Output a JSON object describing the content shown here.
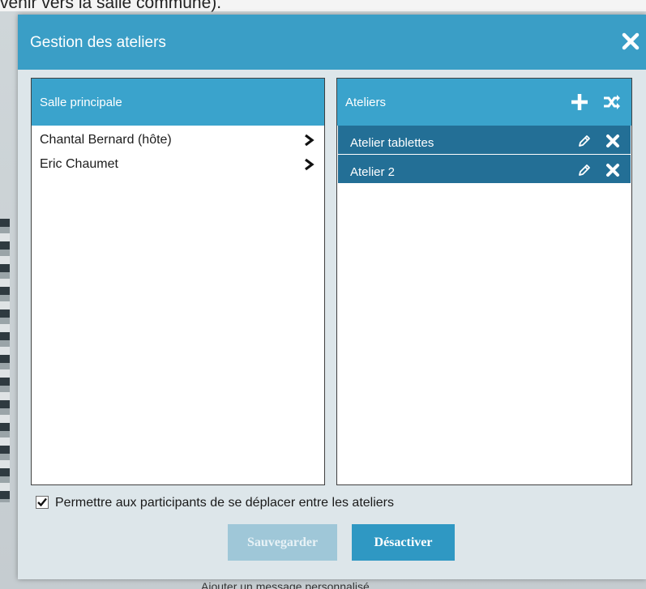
{
  "background": {
    "top_text": "venir vers la salle commune).",
    "bottom_text": "Ajouter un message personnalisé"
  },
  "modal": {
    "title": "Gestion des ateliers",
    "close_icon": "close-icon"
  },
  "main_room": {
    "title": "Salle principale",
    "participants": [
      {
        "name": "Chantal Bernard (hôte)",
        "icon": "chevron-right-icon"
      },
      {
        "name": "Eric Chaumet",
        "icon": "chevron-right-icon"
      }
    ]
  },
  "workshops": {
    "title": "Ateliers",
    "add_icon": "plus-icon",
    "shuffle_icon": "shuffle-icon",
    "items": [
      {
        "name": "Atelier tablettes",
        "edit_icon": "pencil-icon",
        "delete_icon": "close-icon"
      },
      {
        "name": "Atelier 2",
        "edit_icon": "pencil-icon",
        "delete_icon": "close-icon"
      }
    ]
  },
  "options": {
    "allow_move_label": "Permettre aux participants de se déplacer entre les ateliers",
    "allow_move_checked": true
  },
  "buttons": {
    "save_label": "Sauvegarder",
    "deactivate_label": "Désactiver"
  },
  "colors": {
    "header": "#3a9ec6",
    "panel_header": "#3aa3cc",
    "workshop_row": "#236f96",
    "save_disabled": "#9fc7d8",
    "deactivate": "#2f98c3"
  }
}
